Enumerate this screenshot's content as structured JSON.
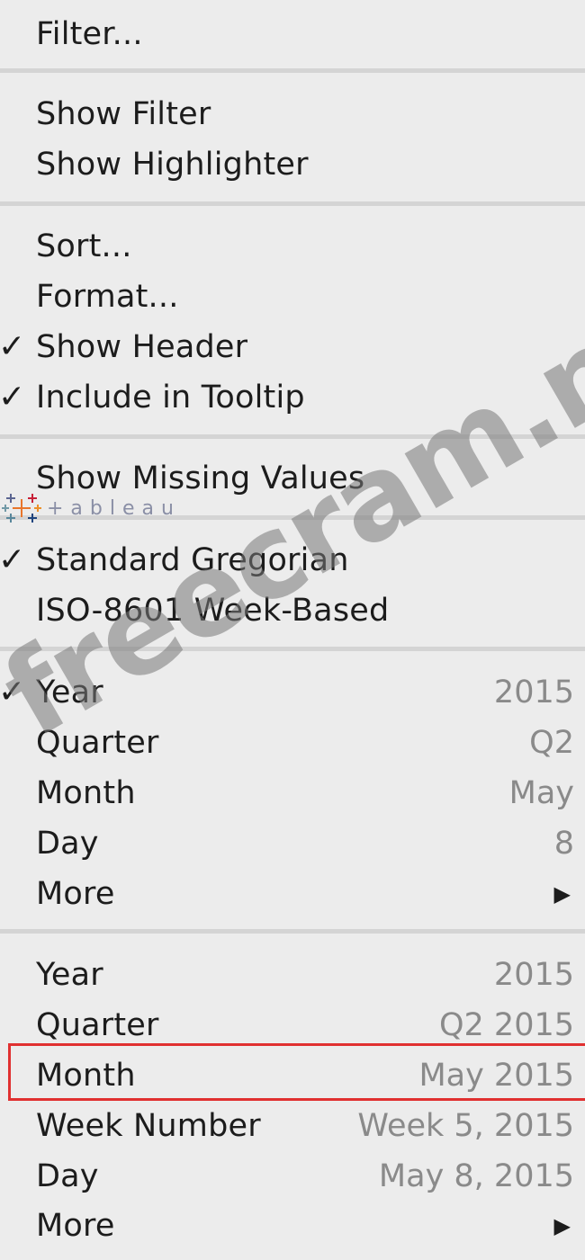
{
  "menu": {
    "filter": "Filter...",
    "show_filter": "Show Filter",
    "show_highlighter": "Show Highlighter",
    "sort": "Sort...",
    "format": "Format...",
    "show_header": "Show Header",
    "include_in_tooltip": "Include in Tooltip",
    "show_missing_values": "Show Missing Values",
    "standard_gregorian": "Standard Gregorian",
    "iso_week": "ISO-8601 Week-Based",
    "checkmark": "✓",
    "submenu_arrow": "▶",
    "discrete": {
      "year": {
        "label": "Year",
        "value": "2015",
        "checked": true
      },
      "quarter": {
        "label": "Quarter",
        "value": "Q2"
      },
      "month": {
        "label": "Month",
        "value": "May"
      },
      "day": {
        "label": "Day",
        "value": "8"
      },
      "more": {
        "label": "More"
      }
    },
    "continuous": {
      "year": {
        "label": "Year",
        "value": "2015"
      },
      "quarter": {
        "label": "Quarter",
        "value": "Q2 2015"
      },
      "month": {
        "label": "Month",
        "value": "May 2015",
        "highlighted": true
      },
      "week": {
        "label": "Week Number",
        "value": "Week 5, 2015"
      },
      "day": {
        "label": "Day",
        "value": "May 8, 2015"
      },
      "more": {
        "label": "More"
      }
    }
  },
  "overlay": {
    "tableau_logo_text": "+ableau",
    "watermark_text": "freecram.net"
  },
  "colors": {
    "background": "#ececec",
    "separator": "#d4d4d4",
    "highlight_border": "#e03030",
    "value_text": "#8a8a8a"
  }
}
